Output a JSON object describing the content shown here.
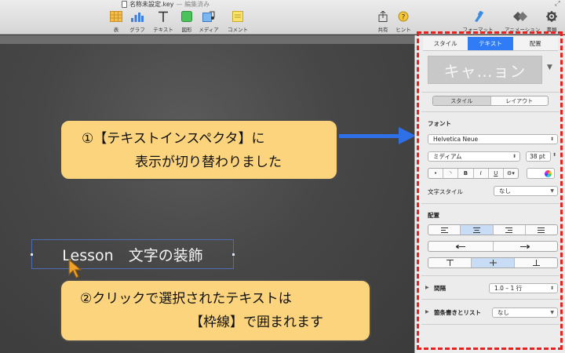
{
  "window": {
    "title": "名称未設定.key",
    "status": "— 編集済み"
  },
  "toolbar": {
    "items": [
      {
        "label": "表",
        "icon": "table-icon"
      },
      {
        "label": "グラフ",
        "icon": "chart-icon"
      },
      {
        "label": "テキスト",
        "icon": "text-icon"
      },
      {
        "label": "図形",
        "icon": "shape-icon"
      },
      {
        "label": "メディア",
        "icon": "media-icon"
      },
      {
        "label": "コメント",
        "icon": "comment-icon"
      },
      {
        "label": "共有",
        "icon": "share-icon"
      },
      {
        "label": "ヒント",
        "icon": "hint-icon"
      },
      {
        "label": "フォーマット",
        "icon": "format-brush-icon"
      },
      {
        "label": "アニメーション",
        "icon": "animation-icon"
      },
      {
        "label": "書類",
        "icon": "document-gear-icon"
      }
    ]
  },
  "canvas": {
    "selected_text": "Lesson　文字の装飾"
  },
  "callouts": {
    "top": {
      "line1": "①【テキストインスペクタ】に",
      "line2": "表示が切り替わりました"
    },
    "bottom": {
      "line1": "②クリックで選択されたテキストは",
      "line2": "【枠線】で囲まれます"
    }
  },
  "inspector": {
    "tabs": [
      "スタイル",
      "テキスト",
      "配置"
    ],
    "active_tab": "テキスト",
    "style_preview": "キャ…ョン",
    "subtabs": [
      "スタイル",
      "レイアウト"
    ],
    "font_section": "フォント",
    "font_family": "Helvetica Neue",
    "font_weight": "ミディアム",
    "font_size": "38 pt",
    "style_buttons": [
      "•",
      "◝",
      "B",
      "I",
      "U",
      "⚙▾"
    ],
    "char_style_label": "文字スタイル",
    "char_style_value": "なし",
    "alignment_section": "配置",
    "align_buttons": [
      "left-align-icon",
      "center-align-icon",
      "right-align-icon",
      "justify-icon"
    ],
    "indent_buttons": [
      "outdent-icon",
      "indent-icon"
    ],
    "valign_buttons": [
      "top-align-icon",
      "middle-align-icon",
      "bottom-align-icon"
    ],
    "spacing_label": "間隔",
    "spacing_value": "1.0 – 1 行",
    "bullets_label": "箇条書きとリスト",
    "bullets_value": "なし"
  },
  "colors": {
    "accent": "#2f7cf6",
    "callout_fill": "#fcd47d",
    "arrow": "#2f6fe8",
    "highlight_frame": "#e8201e"
  }
}
